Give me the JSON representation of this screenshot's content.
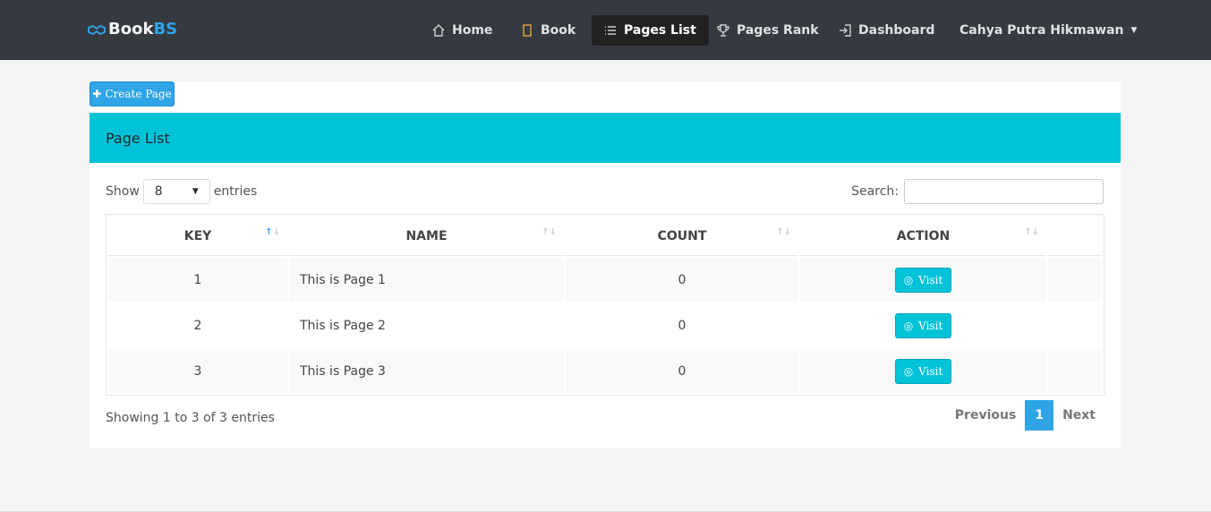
{
  "nav": {
    "brand_main": "Book",
    "brand_accent": "BS",
    "items": [
      {
        "label": "Home",
        "icon": "home-icon"
      },
      {
        "label": "Book",
        "icon": "book-icon"
      },
      {
        "label": "Pages List",
        "icon": "list-icon",
        "active": true
      },
      {
        "label": "Pages Rank",
        "icon": "trophy-icon"
      },
      {
        "label": "Dashboard",
        "icon": "sign-in-icon"
      }
    ],
    "user": "Cahya Putra Hikmawan"
  },
  "create_label": "Create Page",
  "panel_title": "Page List",
  "length": {
    "show": "Show",
    "value": "8",
    "entries": "entries"
  },
  "search": {
    "label": "Search:",
    "value": ""
  },
  "table": {
    "headers": [
      "KEY",
      "NAME",
      "COUNT",
      "ACTION"
    ],
    "rows": [
      {
        "key": "1",
        "name": "This is Page 1",
        "count": "0",
        "action": "Visit"
      },
      {
        "key": "2",
        "name": "This is Page 2",
        "count": "0",
        "action": "Visit"
      },
      {
        "key": "3",
        "name": "This is Page 3",
        "count": "0",
        "action": "Visit"
      }
    ]
  },
  "info": "Showing 1 to 3 of 3 entries",
  "pager": {
    "prev": "Previous",
    "current": "1",
    "next": "Next"
  },
  "colors": {
    "navbar": "#343a40",
    "primary": "#2fa4e7",
    "info": "#00c3d8"
  }
}
